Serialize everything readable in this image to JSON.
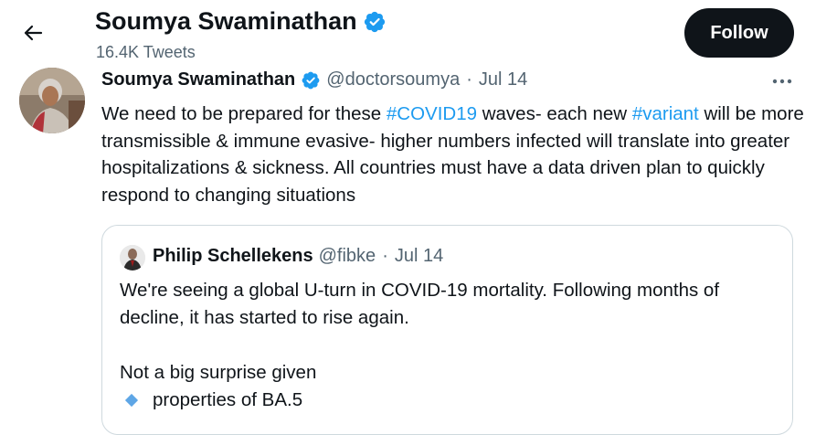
{
  "header": {
    "name": "Soumya Swaminathan",
    "tweet_count": "16.4K Tweets",
    "follow_label": "Follow"
  },
  "tweet": {
    "author_name": "Soumya Swaminathan",
    "handle": "@doctorsoumya",
    "separator": "·",
    "date": "Jul 14",
    "text": {
      "part1": "We need to be prepared for these ",
      "hashtag1": "#COVID19",
      "part2": " waves- each new ",
      "hashtag2": "#variant",
      "part3": " will be more transmissible & immune evasive- higher numbers infected will translate into greater hospitalizations & sickness. All countries must have a data driven plan to quickly respond to changing situations"
    }
  },
  "quote": {
    "author_name": "Philip Schellekens",
    "handle": "@fibke",
    "separator": "·",
    "date": "Jul 14",
    "para1": "We're seeing a global U-turn in COVID-19 mortality. Following months of decline, it has started to rise again.",
    "para2": "Not a big surprise given",
    "bullet1": "properties of BA.5"
  },
  "colors": {
    "accent": "#1d9bf0",
    "text_primary": "#0f1419",
    "text_secondary": "#536471",
    "follow_bg": "#0f1419",
    "border": "#cfd9de",
    "bullet": "#5ea6e6"
  },
  "icons": {
    "back": "arrow-left-icon",
    "verified": "verified-badge-icon",
    "more": "more-horizontal-icon",
    "bullet": "blue-diamond-icon"
  }
}
